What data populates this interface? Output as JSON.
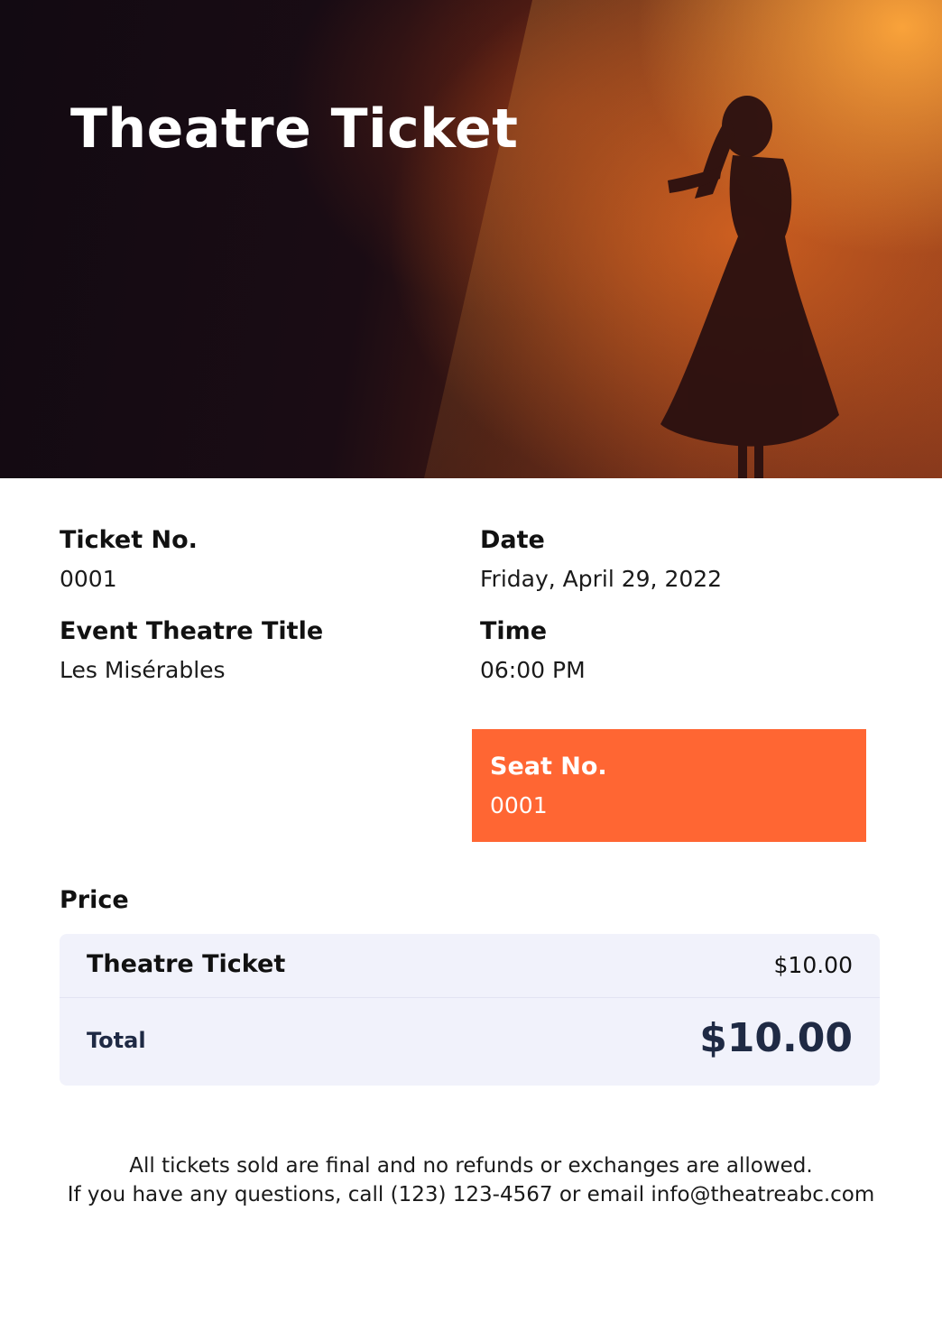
{
  "header": {
    "title": "Theatre Ticket"
  },
  "details": {
    "ticket_no_label": "Ticket No.",
    "ticket_no_value": "0001",
    "date_label": "Date",
    "date_value": "Friday, April 29, 2022",
    "event_label": "Event Theatre Title",
    "event_value": "Les Misérables",
    "time_label": "Time",
    "time_value": "06:00 PM"
  },
  "seat": {
    "label": "Seat No.",
    "value": "0001"
  },
  "price": {
    "heading": "Price",
    "item_name": "Theatre Ticket",
    "item_amount": "$10.00",
    "total_label": "Total",
    "total_amount": "$10.00"
  },
  "footer": {
    "line1": "All tickets sold are final and no refunds or exchanges are allowed.",
    "line2": "If you have any questions, call (123) 123-4567 or email info@theatreabc.com"
  },
  "colors": {
    "accent": "#ff6633",
    "card_bg": "#f1f2fb",
    "total_text": "#1f2a44"
  }
}
